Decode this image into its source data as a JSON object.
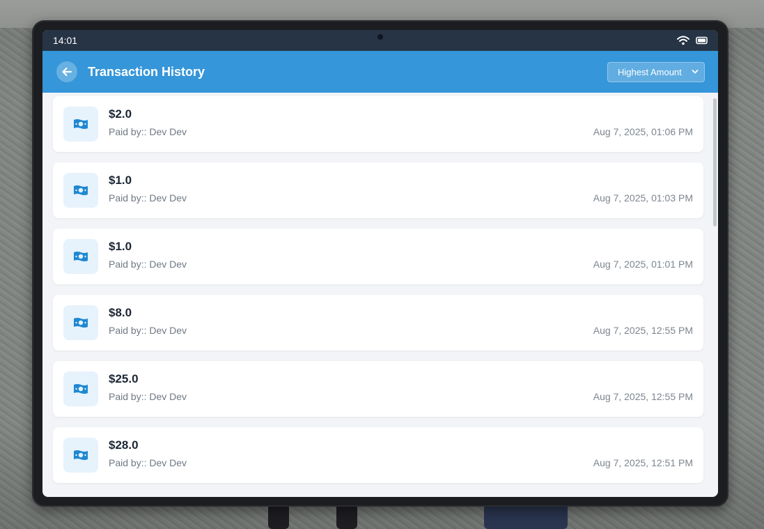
{
  "status_bar": {
    "time": "14:01",
    "icons": [
      "wifi-icon",
      "battery-icon"
    ]
  },
  "header": {
    "title": "Transaction History",
    "back_icon": "arrow-left-icon",
    "sort": {
      "selected": "Highest Amount",
      "icon": "chevron-down-icon"
    }
  },
  "colors": {
    "header_bg": "#3596d9",
    "status_bg": "#263445",
    "accent": "#1e88d2",
    "list_bg": "#f2f4f7"
  },
  "transactions": [
    {
      "amount": "$2.0",
      "payer": "Paid by:: Dev Dev",
      "date": "Aug 7, 2025, 01:06 PM",
      "icon": "money-bill-icon"
    },
    {
      "amount": "$1.0",
      "payer": "Paid by:: Dev Dev",
      "date": "Aug 7, 2025, 01:03 PM",
      "icon": "money-bill-icon"
    },
    {
      "amount": "$1.0",
      "payer": "Paid by:: Dev Dev",
      "date": "Aug 7, 2025, 01:01 PM",
      "icon": "money-bill-icon"
    },
    {
      "amount": "$8.0",
      "payer": "Paid by:: Dev Dev",
      "date": "Aug 7, 2025, 12:55 PM",
      "icon": "money-bill-icon"
    },
    {
      "amount": "$25.0",
      "payer": "Paid by:: Dev Dev",
      "date": "Aug 7, 2025, 12:55 PM",
      "icon": "money-bill-icon"
    },
    {
      "amount": "$28.0",
      "payer": "Paid by:: Dev Dev",
      "date": "Aug 7, 2025, 12:51 PM",
      "icon": "money-bill-icon"
    }
  ]
}
